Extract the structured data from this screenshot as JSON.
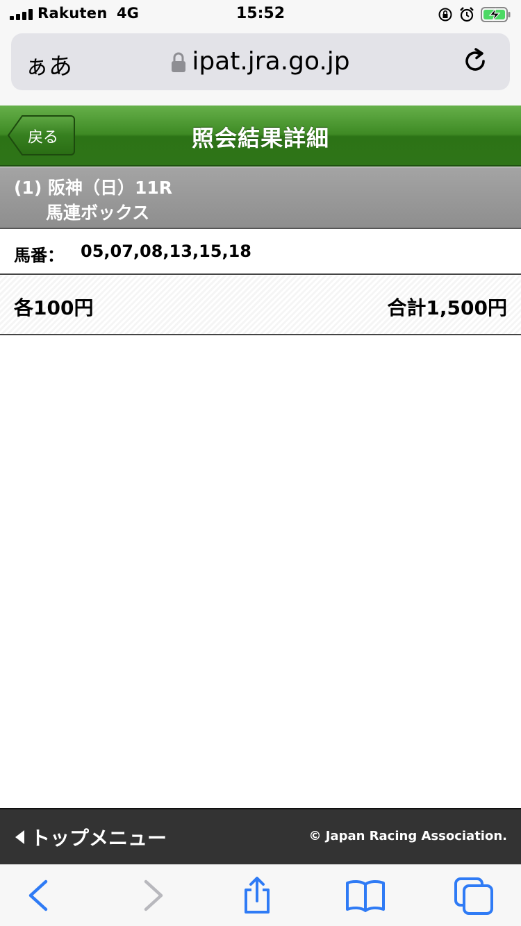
{
  "status_bar": {
    "carrier": "Rakuten",
    "network": "4G",
    "time": "15:52"
  },
  "browser": {
    "text_size_label": "ぁあ",
    "domain": "ipat.jra.go.jp"
  },
  "header": {
    "back_label": "戻る",
    "title": "照会結果詳細"
  },
  "race": {
    "line1": "(1) 阪神（日）11R",
    "bet_type": "馬連ボックス"
  },
  "ticket": {
    "numbers_label": "馬番：",
    "numbers": "05,07,08,13,15,18",
    "unit_amount": "各100円",
    "total_amount": "合計1,500円"
  },
  "footer": {
    "top_menu_label": "トップメニュー",
    "copyright": "© Japan Racing Association."
  },
  "colors": {
    "header_green": "#3e8a24",
    "race_gray": "#999999",
    "footer_dark": "#333333",
    "ios_blue": "#2f7bf5",
    "battery_green": "#4cd964"
  },
  "icons": {
    "lock": "lock-icon",
    "reload": "reload-icon",
    "back": "chevron-left-icon",
    "forward": "chevron-right-icon",
    "share": "share-icon",
    "bookmarks": "book-icon",
    "tabs": "tabs-icon"
  }
}
